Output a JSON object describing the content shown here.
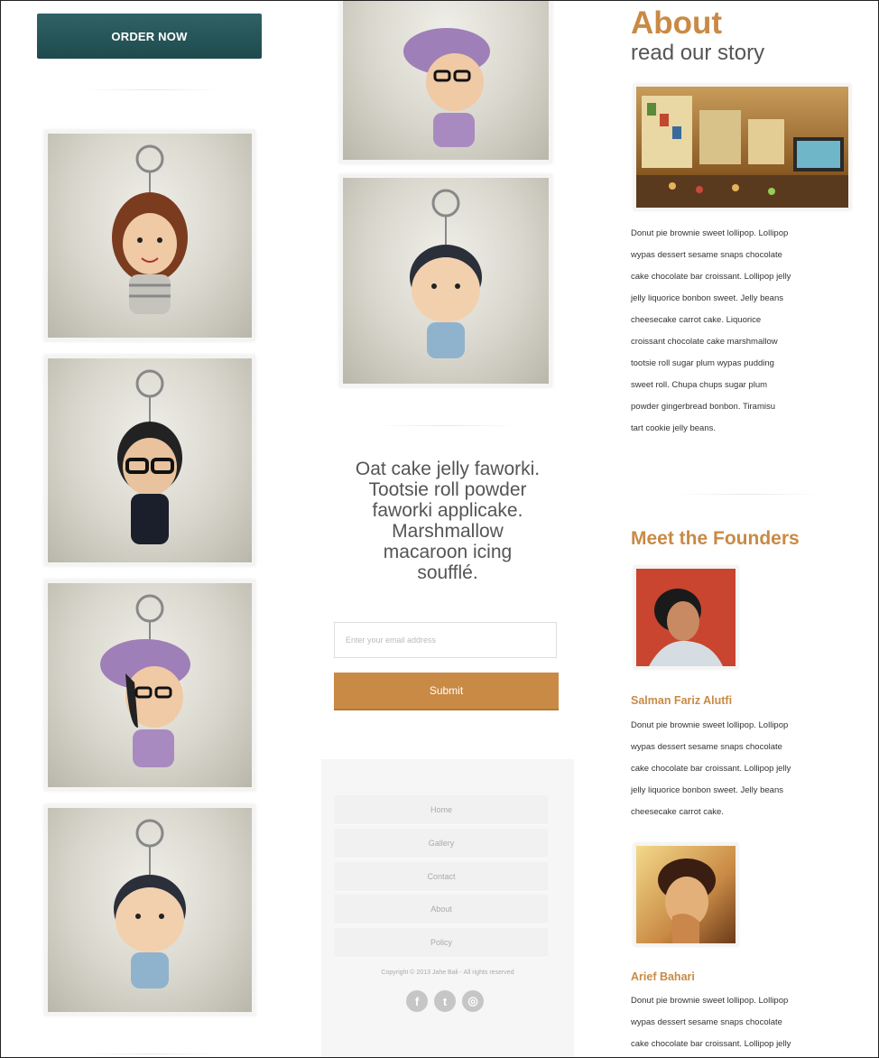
{
  "order_button": "ORDER NOW",
  "gallery_left": [
    {
      "subject": "girl-keychain"
    },
    {
      "subject": "man-glasses-keychain"
    },
    {
      "subject": "girl-beret-keychain"
    },
    {
      "subject": "baby-keychain"
    }
  ],
  "gallery_mid": [
    {
      "subject": "girl-beret-keychain"
    },
    {
      "subject": "baby-keychain"
    }
  ],
  "tagline": {
    "lines": [
      "Oat cake jelly faworki.",
      "Tootsie roll powder",
      "faworki applicake.",
      "Marshmallow",
      "macaroon icing",
      "soufflé."
    ]
  },
  "newsletter": {
    "placeholder": "Enter your email address",
    "submit_label": "Submit"
  },
  "footer": {
    "links": [
      "Home",
      "Gallery",
      "Contact",
      "About",
      "Policy"
    ],
    "copyright": "Copyright © 2013 Jahe Bali - All rights reserved",
    "social": [
      {
        "icon": "facebook-icon",
        "glyph": "f"
      },
      {
        "icon": "twitter-icon",
        "glyph": "t"
      },
      {
        "icon": "dribbble-icon",
        "glyph": "◎"
      }
    ]
  },
  "about": {
    "title": "About",
    "subtitle": "read our story",
    "body_lines": [
      "Donut pie brownie sweet lollipop. Lollipop",
      "wypas dessert sesame snaps chocolate",
      "cake chocolate bar croissant. Lollipop jelly",
      "jelly liquorice bonbon sweet. Jelly beans",
      "cheesecake carrot cake. Liquorice",
      "croissant chocolate cake marshmallow",
      "tootsie roll sugar plum wypas pudding",
      "sweet roll. Chupa chups sugar plum",
      "powder gingerbread bonbon. Tiramisu",
      "tart cookie jelly beans."
    ]
  },
  "founders": {
    "title": "Meet the Founders",
    "people": [
      {
        "name": "Salman Fariz Alutfi",
        "bio_lines": [
          "Donut pie brownie sweet lollipop. Lollipop",
          "wypas dessert sesame snaps chocolate",
          "cake chocolate bar croissant. Lollipop jelly",
          "jelly liquorice bonbon sweet. Jelly beans",
          "cheesecake carrot cake."
        ]
      },
      {
        "name": "Arief Bahari",
        "bio_lines": [
          "Donut pie brownie sweet lollipop. Lollipop",
          "wypas dessert sesame snaps chocolate",
          "cake chocolate bar croissant. Lollipop jelly"
        ]
      }
    ]
  },
  "colors": {
    "accent": "#c98a45",
    "button_dark": "#2f6266"
  }
}
